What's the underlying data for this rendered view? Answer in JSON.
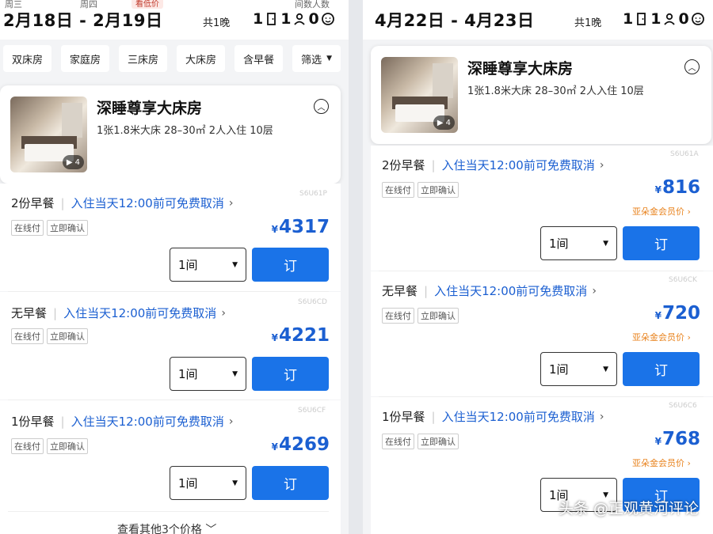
{
  "left": {
    "weekday_in": "周三",
    "weekday_out": "周四",
    "low_price_tag": "看低价",
    "guest_hint": "间数人数",
    "dates": "2月18日 - 2月19日",
    "nights": "共1晚",
    "rooms_count": "1",
    "adults_count": "1",
    "children_count": "0",
    "filters": [
      "双床房",
      "家庭房",
      "三床房",
      "大床房",
      "含早餐",
      "筛选"
    ],
    "room": {
      "name": "深睡尊享大床房",
      "spec": "1张1.8米大床  28–30㎡  2人入住  10层",
      "media_count": "4"
    },
    "rates": [
      {
        "meal": "2份早餐",
        "cancel": "入住当天12:00前可免费取消",
        "code": "S6U61P",
        "tags": [
          "在线付",
          "立即确认"
        ],
        "yen": "¥",
        "price": "4317",
        "qty": "1间",
        "book": "订"
      },
      {
        "meal": "无早餐",
        "cancel": "入住当天12:00前可免费取消",
        "code": "S6U6CD",
        "tags": [
          "在线付",
          "立即确认"
        ],
        "yen": "¥",
        "price": "4221",
        "qty": "1间",
        "book": "订"
      },
      {
        "meal": "1份早餐",
        "cancel": "入住当天12:00前可免费取消",
        "code": "S6U6CF",
        "tags": [
          "在线付",
          "立即确认"
        ],
        "yen": "¥",
        "price": "4269",
        "qty": "1间",
        "book": "订"
      }
    ],
    "more": "查看其他3个价格"
  },
  "right": {
    "dates": "4月22日 - 4月23日",
    "nights": "共1晚",
    "rooms_count": "1",
    "adults_count": "1",
    "children_count": "0",
    "room": {
      "name": "深睡尊享大床房",
      "spec": "1张1.8米大床  28–30㎡  2人入住  10层",
      "media_count": "4"
    },
    "rates": [
      {
        "meal": "2份早餐",
        "cancel": "入住当天12:00前可免费取消",
        "code": "S6U61A",
        "tags": [
          "在线付",
          "立即确认"
        ],
        "yen": "¥",
        "price": "816",
        "member": "亚朵金会员价",
        "qty": "1间",
        "book": "订"
      },
      {
        "meal": "无早餐",
        "cancel": "入住当天12:00前可免费取消",
        "code": "S6U6CK",
        "tags": [
          "在线付",
          "立即确认"
        ],
        "yen": "¥",
        "price": "720",
        "member": "亚朵金会员价",
        "qty": "1间",
        "book": "订"
      },
      {
        "meal": "1份早餐",
        "cancel": "入住当天12:00前可免费取消",
        "code": "S6U6C6",
        "tags": [
          "在线付",
          "立即确认"
        ],
        "yen": "¥",
        "price": "768",
        "member": "亚朵金会员价",
        "qty": "1间",
        "book": "订"
      }
    ]
  },
  "watermark": "头条 @正观黄河评论",
  "colors": {
    "accent_blue": "#1a73e8",
    "link_blue": "#1b5fd1",
    "member_orange": "#e8821c"
  },
  "icons": [
    "door-icon",
    "adult-icon",
    "child-icon",
    "collapse-chevron-icon",
    "play-icon",
    "dropdown-caret-icon",
    "chevron-right-icon"
  ]
}
